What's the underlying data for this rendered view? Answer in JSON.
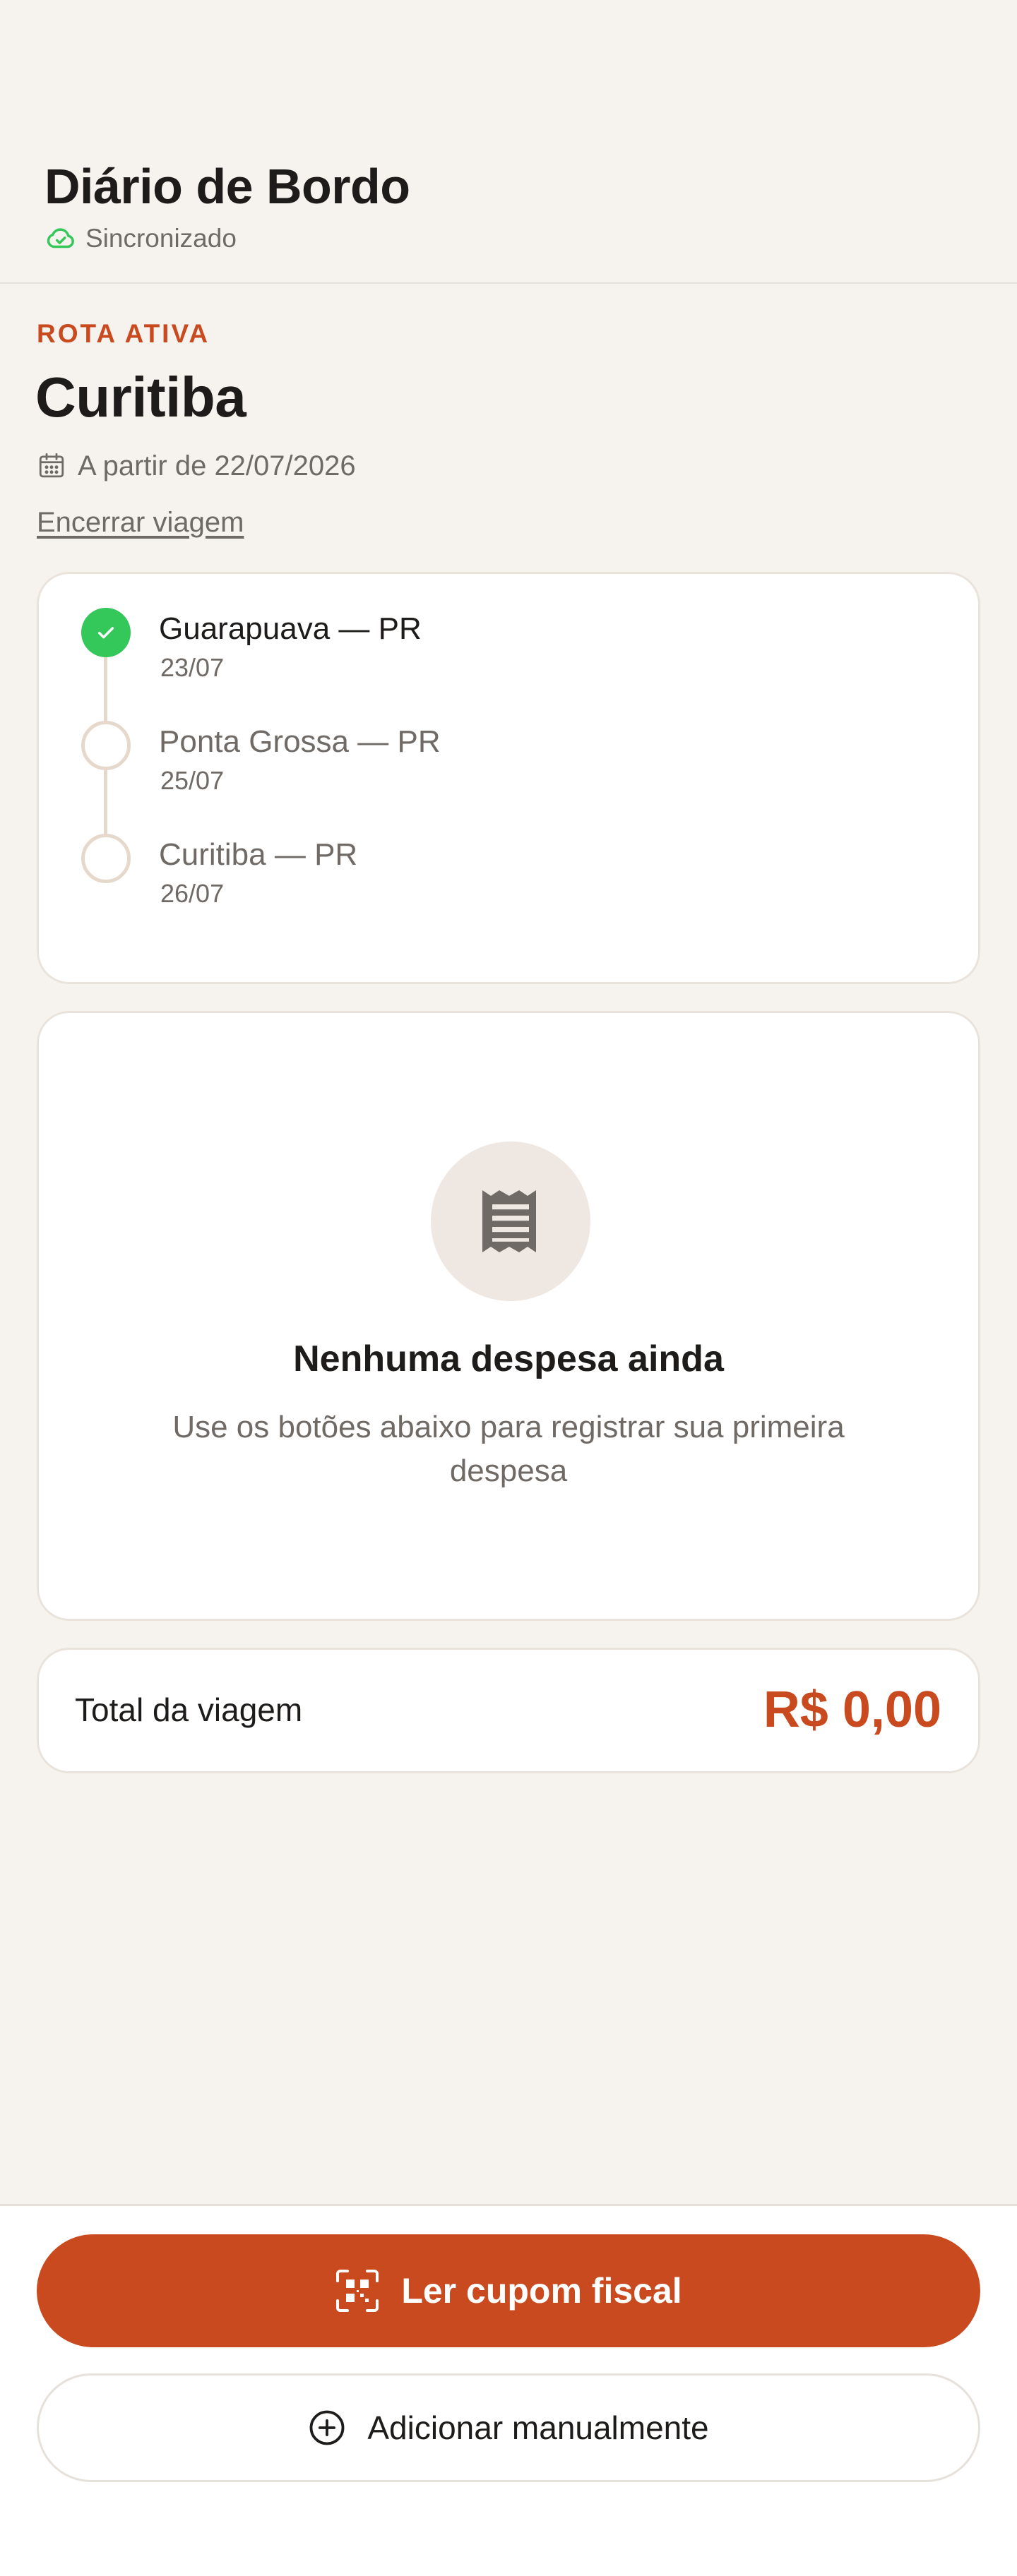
{
  "header": {
    "title": "Diário de Bordo",
    "sync_status": "Sincronizado",
    "sync_icon": "cloud-check-icon"
  },
  "route": {
    "eyebrow": "ROTA ATIVA",
    "destination": "Curitiba",
    "start_date": "A partir de 22/07/2026",
    "end_trip_label": "Encerrar viagem"
  },
  "stops": [
    {
      "name": "Guarapuava — PR",
      "date": "23/07",
      "completed": true
    },
    {
      "name": "Ponta Grossa — PR",
      "date": "25/07",
      "completed": false
    },
    {
      "name": "Curitiba — PR",
      "date": "26/07",
      "completed": false
    }
  ],
  "expenses": {
    "empty_title": "Nenhuma despesa ainda",
    "empty_text": "Use os botões abaixo para registrar sua primeira despesa",
    "empty_icon": "receipt-icon"
  },
  "total": {
    "label": "Total da viagem",
    "value": "R$ 0,00"
  },
  "actions": {
    "scan_label": "Ler cupom fiscal",
    "scan_icon": "qr-scan-icon",
    "manual_label": "Adicionar manualmente",
    "manual_icon": "plus-circle-icon"
  },
  "colors": {
    "accent": "#C94A1E",
    "success": "#34C759",
    "background": "#F6F3EF",
    "muted_text": "#6F6A65"
  }
}
